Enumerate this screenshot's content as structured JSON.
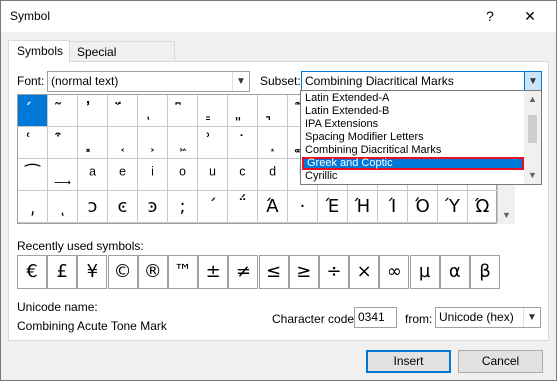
{
  "window": {
    "title": "Symbol",
    "help_glyph": "?",
    "close_glyph": "✕"
  },
  "tabs": [
    {
      "label": "Symbols",
      "active": true
    },
    {
      "label": "Special Characters",
      "active": false
    }
  ],
  "font": {
    "label": "Font:",
    "value": "(normal text)"
  },
  "subset": {
    "label": "Subset:",
    "value": "Combining Diacritical Marks",
    "options": [
      "Latin Extended-A",
      "Latin Extended-B",
      "IPA Extensions",
      "Spacing Modifier Letters",
      "Combining Diacritical Marks",
      "Greek and Coptic",
      "Cyrillic"
    ],
    "highlighted_option": "Greek and Coptic"
  },
  "symbol_grid": {
    "rows": [
      [
        "́",
        "͂",
        "̓",
        "̈́",
        "ͅ",
        "͆",
        "͇",
        "͈",
        "͉",
        "͊",
        "͋",
        "͌",
        "͍",
        "͎",
        "͏",
        "͐"
      ],
      [
        "͑",
        "͒",
        "͓",
        "͔",
        "͕",
        "͖",
        "͗",
        "͘",
        "͙",
        "͚",
        "͛",
        "͜",
        "͝",
        "͞",
        "͟",
        "͠"
      ],
      [
        "͡",
        "͢",
        "ͣ",
        "ͤ",
        "ͥ",
        "ͦ",
        "ͧ",
        "ͨ",
        "ͩ",
        "ͪ",
        "ͫ",
        "ͬ",
        "ͭ",
        "ͮ",
        "ͯ",
        "ʹ"
      ],
      [
        "͵",
        "ͺ",
        "ͻ",
        "ͼ",
        "ͽ",
        ";",
        "΄",
        "΅",
        "Ά",
        "·",
        "Έ",
        "Ή",
        "Ί",
        "Ό",
        "Ύ",
        "Ώ"
      ]
    ],
    "selected": "0,0"
  },
  "recent": {
    "label": "Recently used symbols:",
    "symbols": [
      "€",
      "£",
      "¥",
      "©",
      "®",
      "™",
      "±",
      "≠",
      "≤",
      "≥",
      "÷",
      "×",
      "∞",
      "µ",
      "α",
      "β"
    ]
  },
  "unicode_name": {
    "label": "Unicode name:",
    "value": "Combining Acute Tone Mark"
  },
  "char_code": {
    "label": "Character code:",
    "value": "0341"
  },
  "from": {
    "label": "from:",
    "value": "Unicode (hex)"
  },
  "buttons": {
    "insert": "Insert",
    "cancel": "Cancel"
  }
}
